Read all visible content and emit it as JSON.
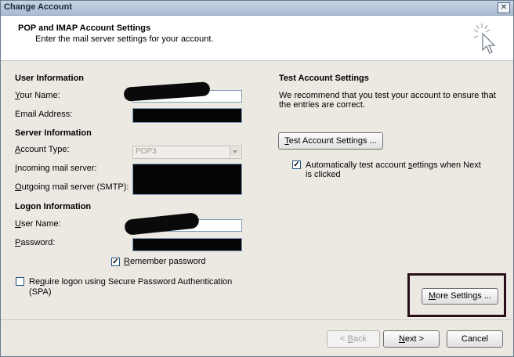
{
  "window": {
    "title": "Change Account",
    "close_glyph": "✕"
  },
  "header": {
    "title": "POP and IMAP Account Settings",
    "subtitle": "Enter the mail server settings for your account.",
    "icon": "cursor-click-icon"
  },
  "user_info": {
    "heading": "User Information",
    "your_name_label_prefix": "",
    "your_name_label_ul": "Y",
    "your_name_label_rest": "our Name:",
    "email_label": "Email Address:"
  },
  "server_info": {
    "heading": "Server Information",
    "account_type_label_ul": "A",
    "account_type_label_rest": "ccount Type:",
    "account_type_value": "POP3",
    "incoming_label_ul": "I",
    "incoming_label_rest": "ncoming mail server:",
    "outgoing_label_ul": "O",
    "outgoing_label_rest": "utgoing mail server (SMTP):"
  },
  "logon_info": {
    "heading": "Logon Information",
    "user_name_label_ul": "U",
    "user_name_label_rest": "ser Name:",
    "password_label_ul": "P",
    "password_label_rest": "assword:",
    "remember_password_ul": "R",
    "remember_password_rest": "emember password",
    "remember_password_checked": true,
    "spa_label_ul": "q",
    "spa_label_pre": "Re",
    "spa_label_rest": "uire logon using Secure Password Authentication",
    "spa_label_line2": "(SPA)",
    "spa_checked": false
  },
  "test_settings": {
    "heading": "Test Account Settings",
    "description_line1": "We recommend that you test your account to ensure that",
    "description_line2": "the entries are correct.",
    "test_button_ul": "T",
    "test_button_rest": "est Account Settings ...",
    "auto_test_pre": "Automatically test account ",
    "auto_test_ul": "s",
    "auto_test_rest": "ettings when Next",
    "auto_test_line2": "is clicked",
    "auto_test_checked": true
  },
  "more_settings": {
    "label_ul": "M",
    "label_rest": "ore Settings ..."
  },
  "footer": {
    "back_pre": "< ",
    "back_ul": "B",
    "back_rest": "ack",
    "next_ul": "N",
    "next_rest": "ext >",
    "cancel": "Cancel"
  },
  "colors": {
    "highlight_border": "#2a0f19",
    "redaction": "#050505"
  }
}
